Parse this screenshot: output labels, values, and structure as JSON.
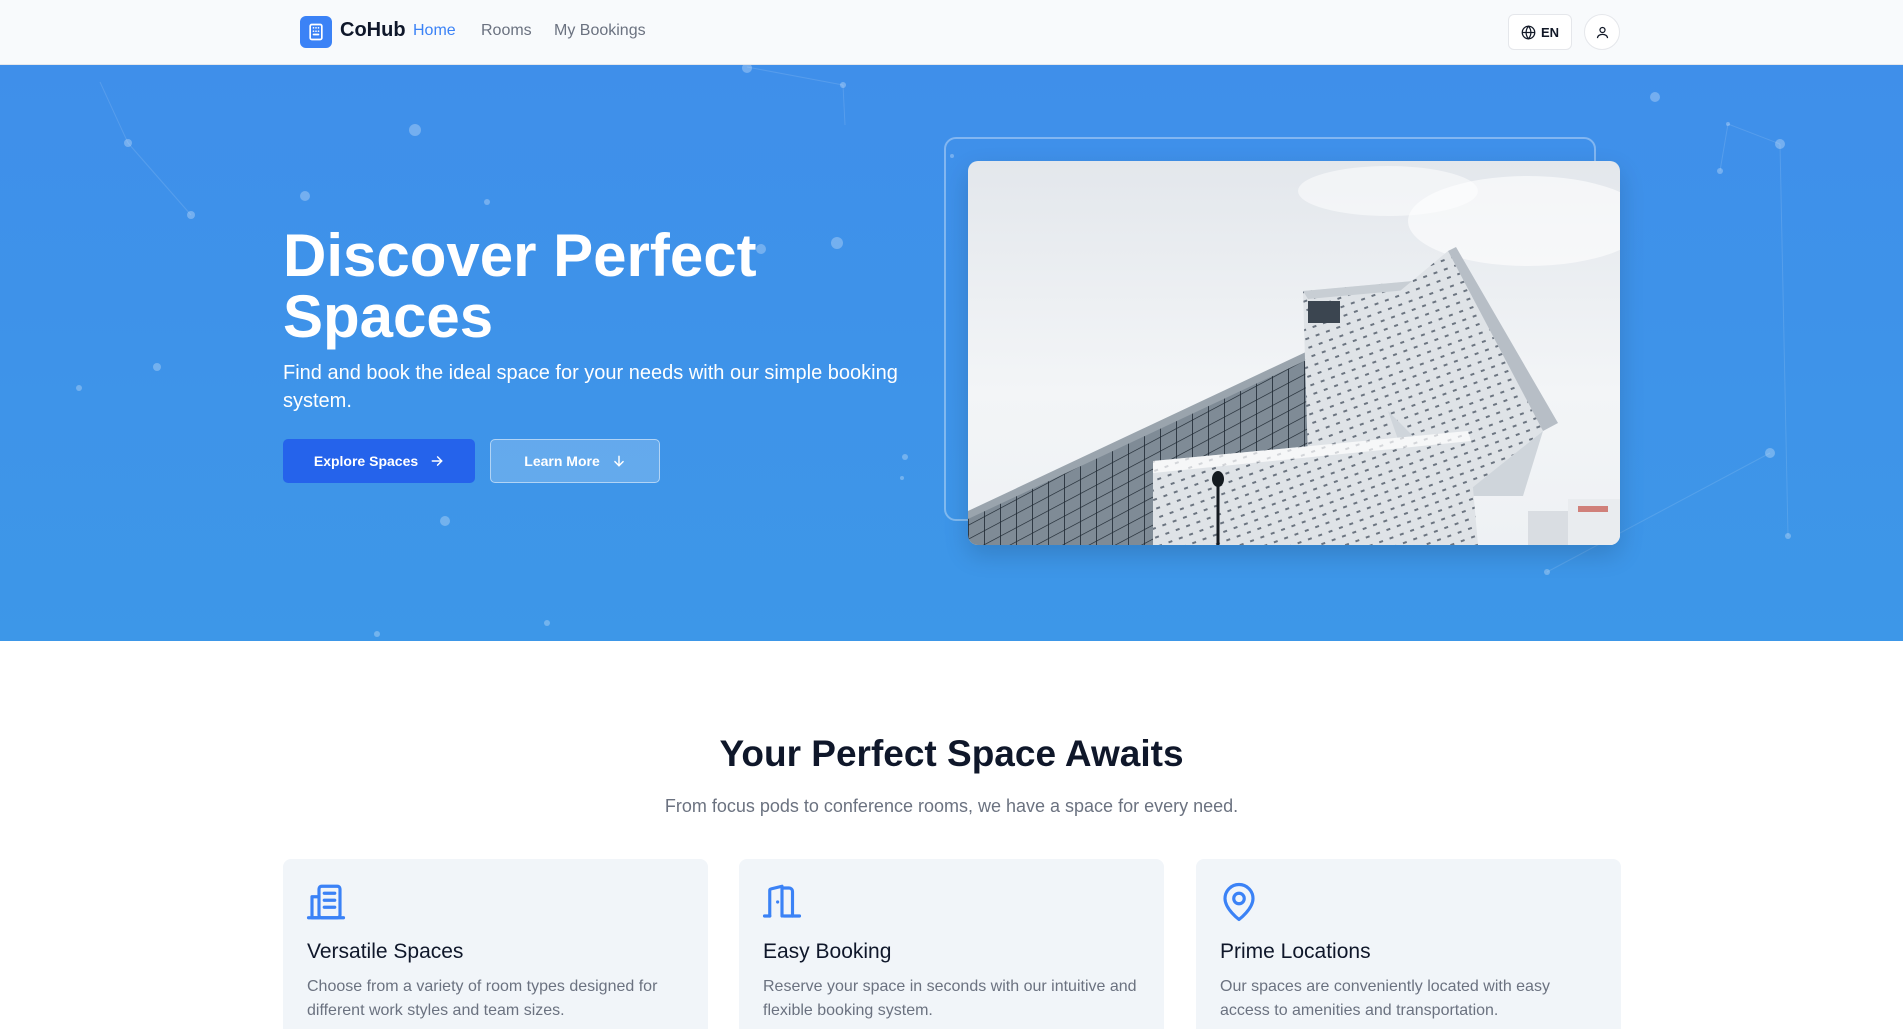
{
  "nav": {
    "brand": "CoHub",
    "links": [
      "Home",
      "Rooms",
      "My Bookings"
    ],
    "active_link": "Home",
    "lang_label": "EN"
  },
  "hero": {
    "title": "Discover Perfect Spaces",
    "subtitle": "Find and book the ideal space for your needs with our simple booking system.",
    "explore_label": "Explore Spaces",
    "learn_label": "Learn More"
  },
  "features": {
    "title": "Your Perfect Space Awaits",
    "subtitle": "From focus pods to conference rooms, we have a space for every need.",
    "cards": [
      {
        "icon": "building-icon",
        "title": "Versatile Spaces",
        "text": "Choose from a variety of room types designed for different work styles and team sizes."
      },
      {
        "icon": "door-icon",
        "title": "Easy Booking",
        "text": "Reserve your space in seconds with our intuitive and flexible booking system."
      },
      {
        "icon": "map-pin-icon",
        "title": "Prime Locations",
        "text": "Our spaces are conveniently located with easy access to amenities and transportation."
      }
    ]
  },
  "colors": {
    "accent": "#3b82f6",
    "hero_bg": "#3f8fea",
    "primary_button": "#2563eb"
  }
}
